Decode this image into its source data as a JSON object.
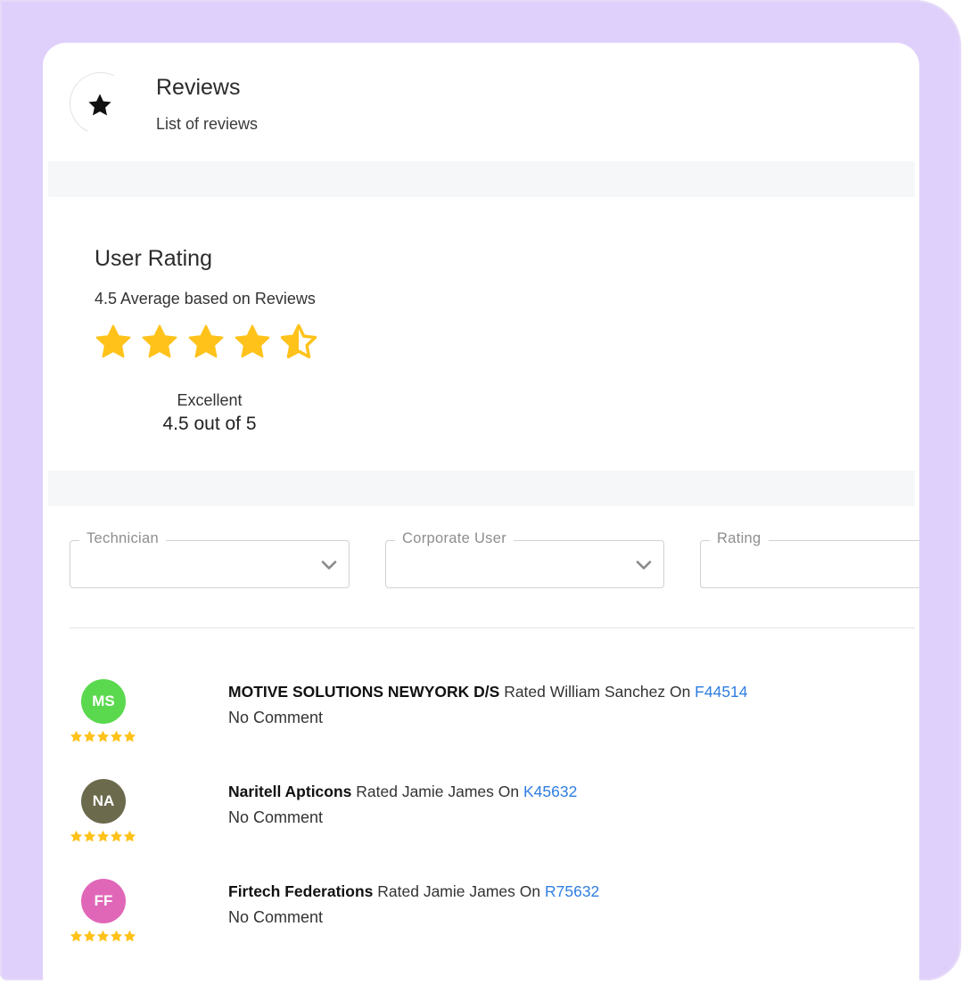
{
  "header": {
    "title": "Reviews",
    "subtitle": "List of reviews",
    "icon": "star-icon"
  },
  "summary": {
    "heading": "User Rating",
    "average_text": "4.5 Average based on Reviews",
    "rating_value": 4.5,
    "rating_max": 5,
    "rating_word": "Excellent",
    "rating_text": "4.5 out of 5"
  },
  "filters": [
    {
      "label": "Technician",
      "value": ""
    },
    {
      "label": "Corporate User",
      "value": ""
    },
    {
      "label": "Rating",
      "value": ""
    }
  ],
  "reviews": [
    {
      "initials": "MS",
      "avatar_color": "#5ad84e",
      "stars": 5,
      "name": "MOTIVE SOLUTIONS NEWYORK D/S",
      "rated_text": " Rated William Sanchez On ",
      "order_id": "F44514",
      "comment": "No Comment"
    },
    {
      "initials": "NA",
      "avatar_color": "#6b6a4c",
      "stars": 5,
      "name": "Naritell Apticons",
      "rated_text": " Rated Jamie James On ",
      "order_id": "K45632",
      "comment": "No Comment"
    },
    {
      "initials": "FF",
      "avatar_color": "#e067b8",
      "stars": 5,
      "name": "Firtech Federations",
      "rated_text": " Rated Jamie James On ",
      "order_id": "R75632",
      "comment": "No Comment"
    }
  ],
  "colors": {
    "star": "#ffc21a",
    "link": "#2f7de1",
    "background": "#dfd0fb"
  }
}
